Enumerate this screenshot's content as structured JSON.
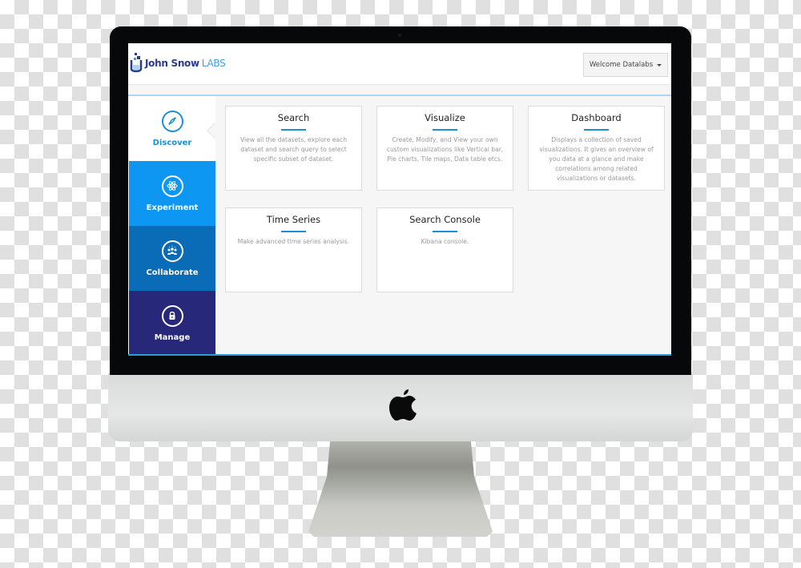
{
  "header": {
    "logo_primary": "John Snow",
    "logo_secondary": "LABS",
    "welcome_label": "Welcome Datalabs"
  },
  "sidebar": {
    "items": [
      {
        "label": "Discover",
        "icon": "compass-icon",
        "active": true
      },
      {
        "label": "Experiment",
        "icon": "atom-icon",
        "active": false
      },
      {
        "label": "Collaborate",
        "icon": "team-icon",
        "active": false
      },
      {
        "label": "Manage",
        "icon": "lock-icon",
        "active": false
      }
    ]
  },
  "cards": [
    {
      "title": "Search",
      "description": "View all the datasets, explore each dataset and search query to select specific subset of dataset."
    },
    {
      "title": "Visualize",
      "description": "Create, Modify, and View your own custom visualizations like Vertical bar, Pie charts, Tile maps, Data table etcs."
    },
    {
      "title": "Dashboard",
      "description": "Displays a collection of saved visualizations. It gives an overview of you data at a glance and make correlations among related visualizations or datasets."
    },
    {
      "title": "Time Series",
      "description": "Make advanced time series analysis."
    },
    {
      "title": "Search Console",
      "description": "Kibana console."
    }
  ],
  "colors": {
    "accent": "#1a8fd6",
    "experiment": "#0d97f2",
    "collaborate": "#0a6cb7",
    "manage": "#27287a"
  }
}
